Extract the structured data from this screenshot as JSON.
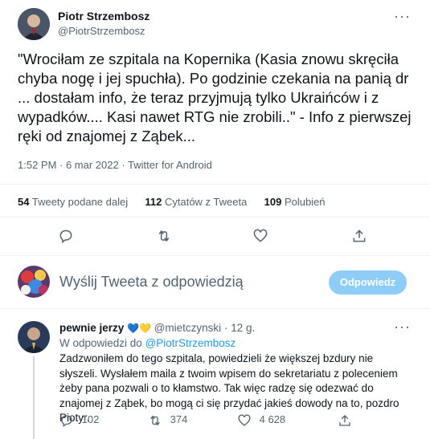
{
  "tweet": {
    "author_name": "Piotr Strzembosz",
    "author_handle": "@PiotrStrzembosz",
    "text": "\"Wrociłam ze szpitala na Kopernika (Kasia znowu skręciła chyba nogę i jej spuchła). Po godzinie czekania na panią dr ... dostałam info, że teraz przyjmują tylko Ukraińców i z wypadków.... Kasi nawet RTG nie zrobili..\" - Info z pierwszej ręki od znajomej z Ząbek...",
    "meta": "1:52 PM · 6 mar 2022 · Twitter for Android",
    "stats": [
      {
        "num": "54",
        "label": "Tweety podane dalej"
      },
      {
        "num": "112",
        "label": "Cytatów z Tweeta"
      },
      {
        "num": "109",
        "label": "Polubień"
      }
    ]
  },
  "compose": {
    "placeholder": "Wyślij Tweeta z odpowiedzią",
    "button": "Odpowiedz"
  },
  "reply": {
    "author_name": "pewnie jerzy",
    "badges": "💙💛",
    "author_handle": "@mietczynski",
    "time": "· 12 g.",
    "in_reply_prefix": "W odpowiedzi do",
    "in_reply_handle": "@PiotrStrzembosz",
    "text": "Zadzwoniłem do tego szpitala, powiedzieli że większej bzdury nie słyszeli. Wysłałem maila z twoim wpisem do sekretariatu z poleceniem żeby pana pozwali o to kłamstwo. Tak więc radzę się odezwać do znajomej z Ząbek, bo mogą ci się przydać jakieś dowody na to, pozdro Piotyr.",
    "replies": "102",
    "retweets": "374",
    "likes": "4 628"
  },
  "colors": {
    "accent": "#1d9bf0",
    "reply_button": "#8ecdf8",
    "muted": "#536471",
    "divider": "#eff3f4"
  }
}
